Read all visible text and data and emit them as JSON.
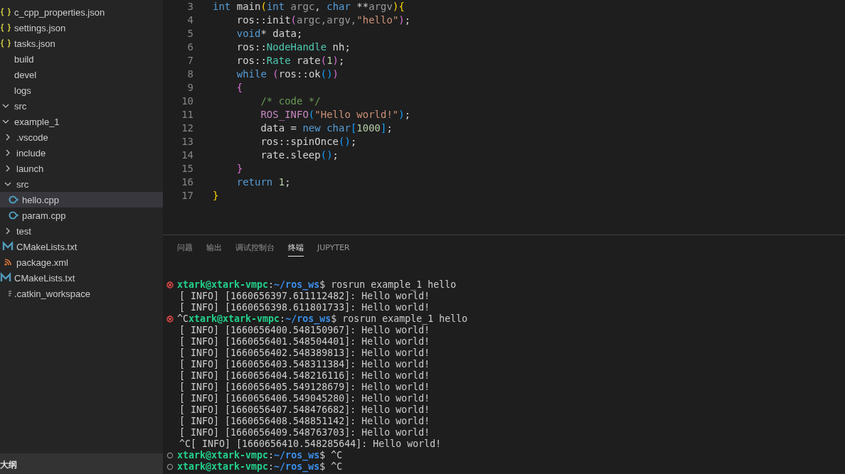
{
  "sidebar": {
    "top_files": [
      {
        "label": "c_cpp_properties.json",
        "kind": "json",
        "selected": false
      },
      {
        "label": "settings.json",
        "kind": "json",
        "selected": false
      },
      {
        "label": "tasks.json",
        "kind": "json",
        "selected": false
      }
    ],
    "tree": [
      {
        "label": "build",
        "kind": "folder",
        "selected": false
      },
      {
        "label": "devel",
        "kind": "folder",
        "selected": false
      },
      {
        "label": "logs",
        "kind": "folder",
        "selected": false
      },
      {
        "label": "src",
        "kind": "folder",
        "expanded": true,
        "selected": false,
        "children": [
          {
            "label": "example_1",
            "kind": "folder",
            "expanded": true,
            "selected": false,
            "children": [
              {
                "label": ".vscode",
                "kind": "folder",
                "expanded": false,
                "selected": false
              },
              {
                "label": "include",
                "kind": "folder",
                "expanded": false,
                "selected": false
              },
              {
                "label": "launch",
                "kind": "folder",
                "expanded": false,
                "selected": false
              },
              {
                "label": "src",
                "kind": "folder",
                "expanded": true,
                "selected": false,
                "children": [
                  {
                    "label": "hello.cpp",
                    "kind": "cpp",
                    "selected": true
                  },
                  {
                    "label": "param.cpp",
                    "kind": "cpp",
                    "selected": false
                  }
                ]
              },
              {
                "label": "test",
                "kind": "folder",
                "expanded": false,
                "selected": false
              },
              {
                "label": "CMakeLists.txt",
                "kind": "cmake",
                "selected": false
              },
              {
                "label": "package.xml",
                "kind": "xml",
                "selected": false
              }
            ]
          },
          {
            "label": "CMakeLists.txt",
            "kind": "cmake",
            "selected": false
          }
        ]
      },
      {
        "label": ".catkin_workspace",
        "kind": "file",
        "selected": false
      }
    ],
    "outline": {
      "title": "大纲"
    }
  },
  "editor": {
    "lines": [
      {
        "number": "3",
        "tokens": [
          {
            "text": "int",
            "kind": "kw"
          },
          {
            "text": " main",
            "kind": "plain"
          },
          {
            "text": "(",
            "kind": "b1"
          },
          {
            "text": "int",
            "kind": "kw"
          },
          {
            "text": " argc",
            "kind": "dim"
          },
          {
            "text": ", ",
            "kind": "plain"
          },
          {
            "text": "char",
            "kind": "kw"
          },
          {
            "text": " **",
            "kind": "plain"
          },
          {
            "text": "argv",
            "kind": "dim"
          },
          {
            "text": ")",
            "kind": "b1"
          },
          {
            "text": "{",
            "kind": "b1"
          }
        ]
      },
      {
        "number": "4",
        "tokens": [
          {
            "text": "    ros::init",
            "kind": "plain"
          },
          {
            "text": "(",
            "kind": "b2"
          },
          {
            "text": "argc,argv,",
            "kind": "dim"
          },
          {
            "text": "\"hello\"",
            "kind": "str"
          },
          {
            "text": ")",
            "kind": "b2"
          },
          {
            "text": ";",
            "kind": "plain"
          }
        ]
      },
      {
        "number": "5",
        "tokens": [
          {
            "text": "    void",
            "kind": "kw"
          },
          {
            "text": "* data;",
            "kind": "plain"
          }
        ]
      },
      {
        "number": "6",
        "tokens": [
          {
            "text": "    ros::",
            "kind": "plain"
          },
          {
            "text": "NodeHandle",
            "kind": "type"
          },
          {
            "text": " nh;",
            "kind": "plain"
          }
        ]
      },
      {
        "number": "7",
        "tokens": [
          {
            "text": "    ros::",
            "kind": "plain"
          },
          {
            "text": "Rate",
            "kind": "type"
          },
          {
            "text": " rate",
            "kind": "plain"
          },
          {
            "text": "(",
            "kind": "b2"
          },
          {
            "text": "1",
            "kind": "num"
          },
          {
            "text": ")",
            "kind": "b2"
          },
          {
            "text": ";",
            "kind": "plain"
          }
        ]
      },
      {
        "number": "8",
        "tokens": [
          {
            "text": "    while ",
            "kind": "kw"
          },
          {
            "text": "(",
            "kind": "b2"
          },
          {
            "text": "ros::ok",
            "kind": "plain"
          },
          {
            "text": "()",
            "kind": "b3"
          },
          {
            "text": ")",
            "kind": "b2"
          }
        ]
      },
      {
        "number": "9",
        "tokens": [
          {
            "text": "    {",
            "kind": "b2"
          }
        ]
      },
      {
        "number": "10",
        "tokens": [
          {
            "text": "        /* code */",
            "kind": "comment"
          }
        ]
      },
      {
        "number": "11",
        "tokens": [
          {
            "text": "        ROS_INFO",
            "kind": "macro"
          },
          {
            "text": "(",
            "kind": "b3"
          },
          {
            "text": "\"Hello world!\"",
            "kind": "str"
          },
          {
            "text": ")",
            "kind": "b3"
          },
          {
            "text": ";",
            "kind": "plain"
          }
        ]
      },
      {
        "number": "12",
        "tokens": [
          {
            "text": "        data = ",
            "kind": "plain"
          },
          {
            "text": "new",
            "kind": "kw"
          },
          {
            "text": " char",
            "kind": "kw"
          },
          {
            "text": "[",
            "kind": "b3"
          },
          {
            "text": "1000",
            "kind": "num"
          },
          {
            "text": "]",
            "kind": "b3"
          },
          {
            "text": ";",
            "kind": "plain"
          }
        ]
      },
      {
        "number": "13",
        "tokens": [
          {
            "text": "        ros::spinOnce",
            "kind": "plain"
          },
          {
            "text": "()",
            "kind": "b3"
          },
          {
            "text": ";",
            "kind": "plain"
          }
        ]
      },
      {
        "number": "14",
        "tokens": [
          {
            "text": "        rate.sleep",
            "kind": "plain"
          },
          {
            "text": "()",
            "kind": "b3"
          },
          {
            "text": ";",
            "kind": "plain"
          }
        ]
      },
      {
        "number": "15",
        "tokens": [
          {
            "text": "    }",
            "kind": "b2"
          }
        ]
      },
      {
        "number": "16",
        "tokens": [
          {
            "text": "    return ",
            "kind": "kw"
          },
          {
            "text": "1",
            "kind": "num"
          },
          {
            "text": ";",
            "kind": "plain"
          }
        ]
      },
      {
        "number": "17",
        "tokens": [
          {
            "text": "}",
            "kind": "b1"
          }
        ]
      }
    ]
  },
  "panel": {
    "tabs": [
      {
        "label": "问题",
        "selected": false
      },
      {
        "label": "输出",
        "selected": false
      },
      {
        "label": "调试控制台",
        "selected": false
      },
      {
        "label": "终端",
        "selected": true
      },
      {
        "label": "JUPYTER",
        "selected": false
      }
    ],
    "terminal": [
      {
        "kind": "prompt",
        "failed": true,
        "user": "xtark@xtark-vmpc",
        "separator": ":",
        "path": "~/ros_ws",
        "command": "$ rosrun example_1 hello"
      },
      {
        "kind": "output",
        "text": "[ INFO] [1660656397.611112482]: Hello world!"
      },
      {
        "kind": "output",
        "text": "[ INFO] [1660656398.611801733]: Hello world!"
      },
      {
        "kind": "prompt",
        "failed": true,
        "prefix": "^C",
        "user": "xtark@xtark-vmpc",
        "separator": ":",
        "path": "~/ros_ws",
        "command": "$ rosrun example_1 hello"
      },
      {
        "kind": "output",
        "text": "[ INFO] [1660656400.548150967]: Hello world!"
      },
      {
        "kind": "output",
        "text": "[ INFO] [1660656401.548504401]: Hello world!"
      },
      {
        "kind": "output",
        "text": "[ INFO] [1660656402.548389813]: Hello world!"
      },
      {
        "kind": "output",
        "text": "[ INFO] [1660656403.548311384]: Hello world!"
      },
      {
        "kind": "output",
        "text": "[ INFO] [1660656404.548216116]: Hello world!"
      },
      {
        "kind": "output",
        "text": "[ INFO] [1660656405.549128679]: Hello world!"
      },
      {
        "kind": "output",
        "text": "[ INFO] [1660656406.549045280]: Hello world!"
      },
      {
        "kind": "output",
        "text": "[ INFO] [1660656407.548476682]: Hello world!"
      },
      {
        "kind": "output",
        "text": "[ INFO] [1660656408.548851142]: Hello world!"
      },
      {
        "kind": "output",
        "text": "[ INFO] [1660656409.548763703]: Hello world!"
      },
      {
        "kind": "output",
        "text": "^C[ INFO] [1660656410.548285644]: Hello world!"
      },
      {
        "kind": "prompt",
        "failed": false,
        "user": "xtark@xtark-vmpc",
        "separator": ":",
        "path": "~/ros_ws",
        "command": "$ ^C"
      },
      {
        "kind": "prompt",
        "failed": false,
        "user": "xtark@xtark-vmpc",
        "separator": ":",
        "path": "~/ros_ws",
        "command": "$ ^C"
      }
    ]
  }
}
